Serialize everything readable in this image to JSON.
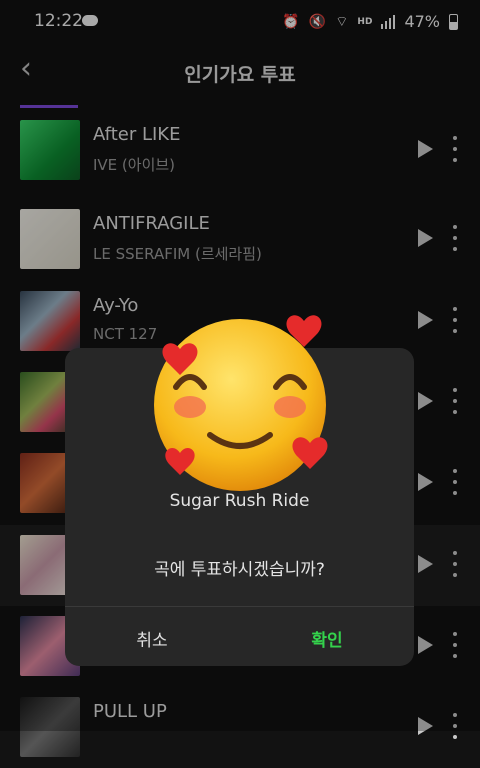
{
  "status_bar": {
    "time": "12:22",
    "battery": "47%",
    "network_label": "HD"
  },
  "app_bar": {
    "back_icon": "chevron-left-icon",
    "title": "인기가요 투표"
  },
  "songs": [
    {
      "title": "After LIKE",
      "artist": "IVE (아이브)"
    },
    {
      "title": "ANTIFRAGILE",
      "artist": "LE SSERAFIM (르세라핌)"
    },
    {
      "title": "Ay-Yo",
      "artist": "NCT 127"
    },
    {
      "title": "",
      "artist": ""
    },
    {
      "title": "",
      "artist": ""
    },
    {
      "title": "",
      "artist": ""
    },
    {
      "title": "",
      "artist": ""
    },
    {
      "title": "PULL UP",
      "artist": ""
    }
  ],
  "dialog": {
    "song": "Sugar Rush Ride",
    "message": "곡에 투표하시겠습니까?",
    "cancel_label": "취소",
    "confirm_label": "확인",
    "confirm_color": "#34d24c"
  },
  "overlay_emoji": "smiling-face-with-hearts-icon"
}
